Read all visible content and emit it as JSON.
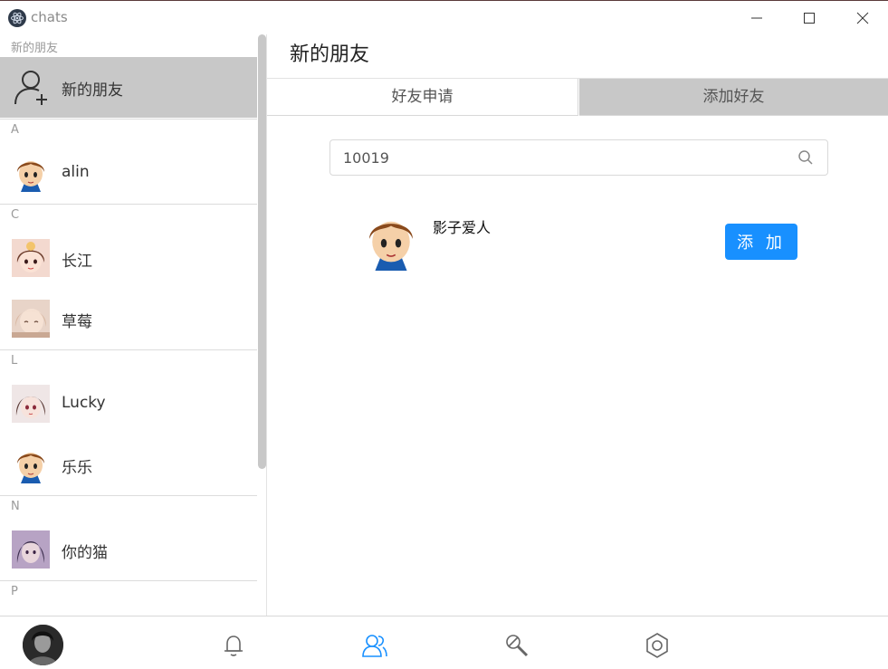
{
  "window": {
    "title": "chats",
    "minimize_icon": "minimize-icon",
    "maximize_icon": "maximize-icon",
    "close_icon": "close-icon"
  },
  "contacts": {
    "new_friends_group": "新的朋友",
    "new_friends_item": "新的朋友",
    "groups": [
      {
        "letter": "A",
        "items": [
          "alin"
        ]
      },
      {
        "letter": "C",
        "items": [
          "长江",
          "草莓"
        ]
      },
      {
        "letter": "L",
        "items": [
          "Lucky",
          "乐乐"
        ]
      },
      {
        "letter": "N",
        "items": [
          "你的猫"
        ]
      },
      {
        "letter": "P",
        "items": []
      }
    ]
  },
  "main": {
    "title": "新的朋友",
    "tabs": [
      {
        "label": "好友申请",
        "active": false
      },
      {
        "label": "添加好友",
        "active": true
      }
    ],
    "search": {
      "value": "10019",
      "placeholder": ""
    },
    "result": {
      "name": "影子爱人",
      "add_label": "添 加"
    }
  },
  "bottom_nav": {
    "icons": [
      "bell-icon",
      "contacts-icon",
      "tools-icon",
      "settings-icon"
    ],
    "active": "contacts-icon"
  },
  "colors": {
    "accent": "#1890ff",
    "selected_bg": "#c8c8c8",
    "active_nav": "#1890ff"
  }
}
